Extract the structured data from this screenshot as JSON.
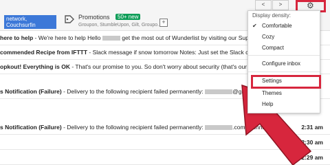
{
  "tabs": {
    "social": {
      "label": "network, Couchsurfin"
    },
    "promotions": {
      "title": "Promotions",
      "badge": "50+ new",
      "senders": "Groupon, StumbleUpon, Gilt, Groupo..."
    },
    "add_label": "+"
  },
  "toolbar": {
    "prev": "<",
    "next": ">",
    "settings_icon": "gear-icon"
  },
  "emails": [
    {
      "sender": "here to help",
      "snippet": " - We're here to help Hello",
      "snippet2": " get the most out of Wunderlist by visiting our Support Ce",
      "time": ""
    },
    {
      "sender": "commended Recipe from IFTTT",
      "snippet": " - Slack message if snow tomorrow Notes: Just set the Slack channel an",
      "snippet2": "",
      "time": ""
    },
    {
      "sender": "opkout! Everything is OK",
      "snippet": " - That's our promise to you. So don't worry about security (that's our job) but",
      "snippet2": "",
      "time": ""
    },
    {
      "sender": "s Notification (Failure)",
      "snippet": " - Delivery to the following recipient failed permanently:",
      "snippet2": "@gm",
      "time": ""
    },
    {
      "sender": "s Notification (Failure)",
      "snippet": " - Delivery to the following recipient failed permanently:",
      "snippet2": ".com Technical c",
      "time": "2:31 am"
    },
    {
      "sender": "",
      "snippet": "",
      "snippet2": "",
      "time": "2:30 am"
    },
    {
      "sender": "",
      "snippet": "",
      "snippet2": "",
      "time": "2:29 am"
    }
  ],
  "settings_menu": {
    "header": "Display density:",
    "check": "✔",
    "density_options": [
      "Comfortable",
      "Cozy",
      "Compact"
    ],
    "configure_inbox": "Configure inbox",
    "settings": "Settings",
    "themes": "Themes",
    "help": "Help"
  },
  "colors": {
    "highlight": "#d7263d",
    "arrow": "#d7263d",
    "promo_badge": "#0f9d58",
    "tab_label": "#3c78d8"
  }
}
